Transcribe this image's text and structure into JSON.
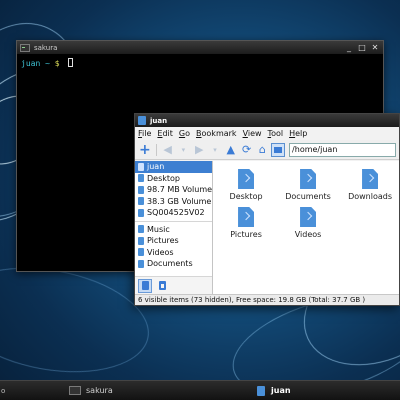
{
  "desktop": {},
  "terminal": {
    "title": "sakura",
    "prompt_user": "juan",
    "prompt_path": "~",
    "prompt_symbol": "$",
    "controls": {
      "minimize": "_",
      "maximize": "□",
      "close": "✕"
    }
  },
  "file_manager": {
    "title": "juan",
    "menu": [
      "File",
      "Edit",
      "Go",
      "Bookmark",
      "View",
      "Tool",
      "Help"
    ],
    "menu_underline": [
      "F",
      "E",
      "G",
      "B",
      "V",
      "T",
      "H"
    ],
    "path_value": "/home/juan",
    "sidebar": {
      "places": [
        {
          "label": "juan",
          "selected": true
        },
        {
          "label": "Desktop",
          "selected": false
        },
        {
          "label": "98.7 MB Volume",
          "selected": false
        },
        {
          "label": "38.3 GB Volume",
          "selected": false
        },
        {
          "label": "SQ004525V02",
          "selected": false
        }
      ],
      "bookmarks": [
        {
          "label": "Music"
        },
        {
          "label": "Pictures"
        },
        {
          "label": "Videos"
        },
        {
          "label": "Documents"
        }
      ]
    },
    "files": [
      {
        "label": "Desktop"
      },
      {
        "label": "Documents"
      },
      {
        "label": "Downloads"
      },
      {
        "label": "Pictures"
      },
      {
        "label": "Videos"
      }
    ],
    "status": "6 visible items (73 hidden), Free space: 19.8 GB (Total: 37.7 GB )",
    "colors": {
      "accent": "#3d7fd1",
      "folder": "#4a90d9"
    }
  },
  "taskbar": {
    "left_label": "o",
    "tasks": [
      {
        "label": "sakura",
        "icon": "terminal-icon"
      },
      {
        "label": "juan",
        "icon": "folder-icon"
      }
    ]
  }
}
